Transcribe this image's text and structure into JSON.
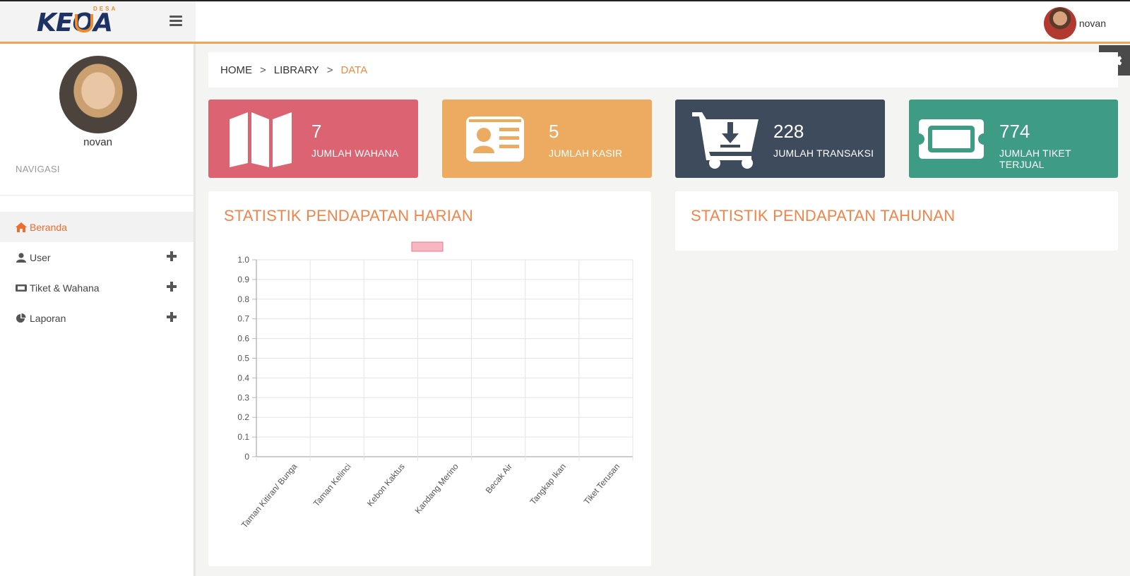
{
  "brand": {
    "logo_text": "KEOA",
    "logo_sub": "DESA"
  },
  "topbar": {
    "user_name": "novan"
  },
  "sidebar": {
    "profile_name": "novan",
    "nav_header": "NAVIGASI",
    "items": [
      {
        "label": "Beranda",
        "icon": "home-icon",
        "active": true
      },
      {
        "label": "User",
        "icon": "user-icon"
      },
      {
        "label": "Tiket & Wahana",
        "icon": "ticket-icon"
      },
      {
        "label": "Laporan",
        "icon": "pie-chart-icon"
      }
    ]
  },
  "breadcrumb": {
    "home": "HOME",
    "library": "LIBRARY",
    "current": "DATA",
    "separator": ">"
  },
  "cards": [
    {
      "value": "7",
      "label": "JUMLAH WAHANA",
      "color": "#dc6472",
      "icon": "map-icon"
    },
    {
      "value": "5",
      "label": "JUMLAH KASIR",
      "color": "#edab62",
      "icon": "id-card-icon"
    },
    {
      "value": "228",
      "label": "JUMLAH TRANSAKSI",
      "color": "#3e4b5c",
      "icon": "cart-download-icon"
    },
    {
      "value": "774",
      "label": "JUMLAH TIKET TERJUAL",
      "color": "#3e9c84",
      "icon": "ticket-icon"
    }
  ],
  "panels": {
    "daily_title": "STATISTIK PENDAPATAN HARIAN",
    "yearly_title": "STATISTIK PENDAPATAN TAHUNAN"
  },
  "colors": {
    "accent": "#f08a3e",
    "legend_fill": "#f7b6c2",
    "legend_stroke": "#e8788c"
  },
  "chart_data": {
    "type": "bar",
    "categories": [
      "Taman Kitiran/ Bunga",
      "Taman Kelinci",
      "Kebon Kaktus",
      "Kandang Merino",
      "Becak Air",
      "Tangkap Ikan",
      "Tiket Terusan"
    ],
    "series": [
      {
        "values": [
          0,
          0,
          0,
          0,
          0,
          0,
          0
        ]
      }
    ],
    "ylim": [
      0,
      1
    ],
    "yticks": [
      "0",
      "0.1",
      "0.2",
      "0.3",
      "0.4",
      "0.5",
      "0.6",
      "0.7",
      "0.8",
      "0.9",
      "1.0"
    ],
    "grid": true,
    "legend": "top"
  }
}
